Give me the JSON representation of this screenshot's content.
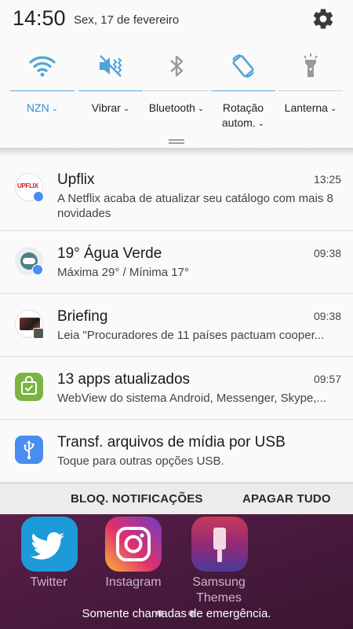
{
  "status_bar": {
    "time": "14:50",
    "date": "Sex, 17 de fevereiro",
    "settings_icon": "gear-icon"
  },
  "quick_settings": [
    {
      "icon": "wifi-icon",
      "label": "NZN",
      "active": true
    },
    {
      "icon": "vibrate-icon",
      "label": "Vibrar",
      "active": true
    },
    {
      "icon": "bluetooth-icon",
      "label": "Bluetooth",
      "active": false
    },
    {
      "icon": "auto-rotate-icon",
      "label": "Rotação autom.",
      "active": true
    },
    {
      "icon": "flashlight-icon",
      "label": "Lanterna",
      "active": false
    }
  ],
  "notifications": [
    {
      "app": "Upflix",
      "time": "13:25",
      "text": "A Netflix acaba de atualizar seu catálogo com mais 8 novidades",
      "icon": "upflix-icon",
      "icon_text": "UPFLIX"
    },
    {
      "app": "19° Água Verde",
      "time": "09:38",
      "text": "Máxima 29° / Mínima 17°",
      "icon": "weather-icon"
    },
    {
      "app": "Briefing",
      "time": "09:38",
      "text": "Leia \"Procuradores de 11 países pactuam cooper...",
      "icon": "briefing-icon"
    },
    {
      "app": "13 apps atualizados",
      "time": "09:57",
      "text": "WebView do sistema Android, Messenger, Skype,...",
      "icon": "galaxy-apps-icon"
    },
    {
      "app": "Transf. arquivos de mídia por USB",
      "time": "",
      "text": "Toque para outras opções USB.",
      "icon": "usb-icon"
    }
  ],
  "actions": {
    "block": "BLOQ. NOTIFICAÇÕES",
    "clear": "APAGAR TUDO"
  },
  "home_apps": [
    {
      "label": "Twitter",
      "icon": "twitter-icon"
    },
    {
      "label": "Instagram",
      "icon": "instagram-icon"
    },
    {
      "label": "Samsung Themes",
      "icon": "samsung-themes-icon"
    }
  ],
  "emergency_text": "Somente chamadas de emergência.",
  "colors": {
    "accent": "#2f8fcd",
    "panel": "#fafafa",
    "wallpaper": "#4a1a3f"
  }
}
